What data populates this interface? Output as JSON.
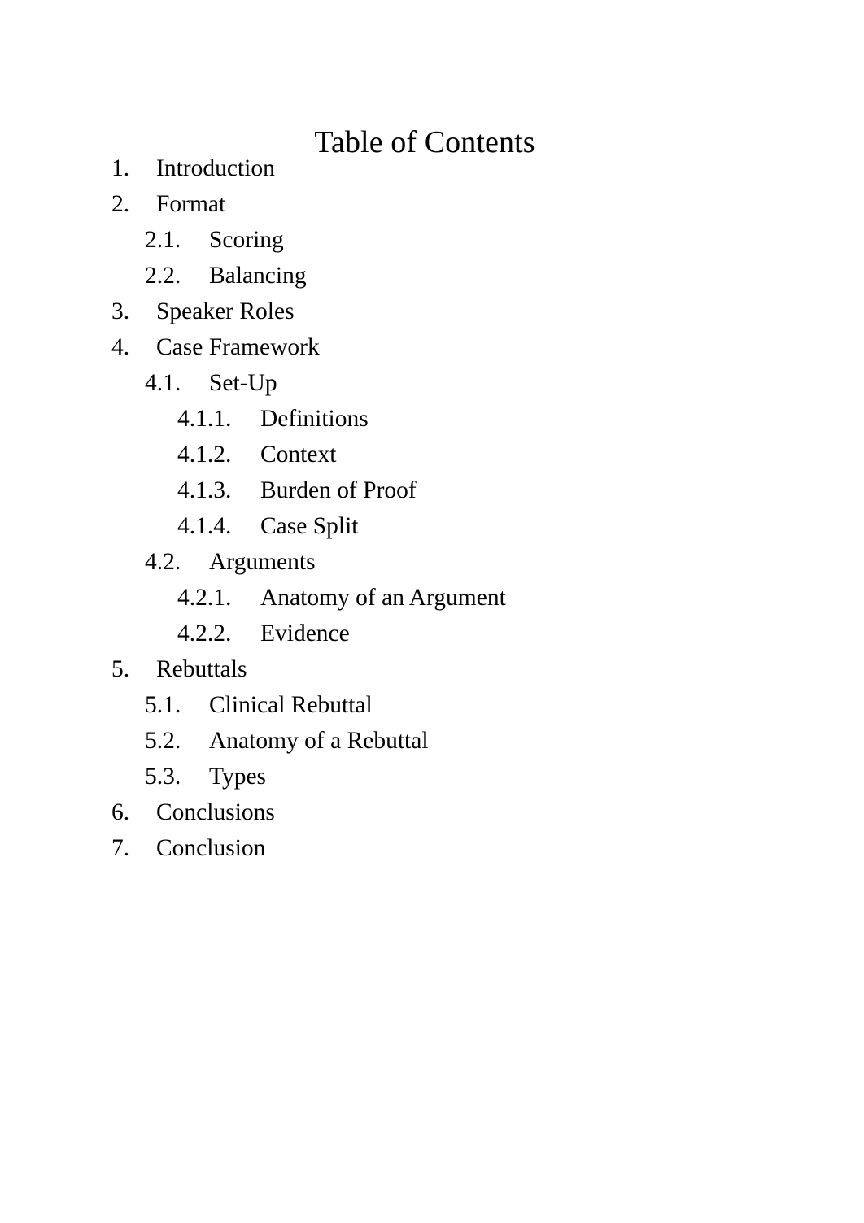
{
  "document": {
    "title": "Table of Contents",
    "page_background": "#ffffff",
    "text_color": "#000000"
  },
  "toc": {
    "entries": [
      {
        "number": "1.",
        "label": "Introduction",
        "level": 1
      },
      {
        "number": "2.",
        "label": "Format",
        "level": 1
      },
      {
        "number": "2.1.",
        "label": "Scoring",
        "level": 2
      },
      {
        "number": "2.2.",
        "label": "Balancing",
        "level": 2
      },
      {
        "number": "3.",
        "label": "Speaker Roles",
        "level": 1
      },
      {
        "number": "4.",
        "label": "Case Framework",
        "level": 1
      },
      {
        "number": "4.1.",
        "label": "Set-Up",
        "level": 2
      },
      {
        "number": "4.1.1.",
        "label": "Definitions",
        "level": 3
      },
      {
        "number": "4.1.2.",
        "label": "Context",
        "level": 3
      },
      {
        "number": "4.1.3.",
        "label": "Burden of Proof",
        "level": 3
      },
      {
        "number": "4.1.4.",
        "label": "Case Split",
        "level": 3
      },
      {
        "number": "4.2.",
        "label": "Arguments",
        "level": 2
      },
      {
        "number": "4.2.1.",
        "label": "Anatomy of an Argument",
        "level": 3
      },
      {
        "number": "4.2.2.",
        "label": "Evidence",
        "level": 3
      },
      {
        "number": "5.",
        "label": "Rebuttals",
        "level": 1
      },
      {
        "number": "5.1.",
        "label": "Clinical Rebuttal",
        "level": 2
      },
      {
        "number": "5.2.",
        "label": "Anatomy of a Rebuttal",
        "level": 2
      },
      {
        "number": "5.3.",
        "label": "Types",
        "level": 2
      },
      {
        "number": "6.",
        "label": "Conclusions",
        "level": 1
      },
      {
        "number": "7.",
        "label": "Conclusion",
        "level": 1
      }
    ]
  }
}
